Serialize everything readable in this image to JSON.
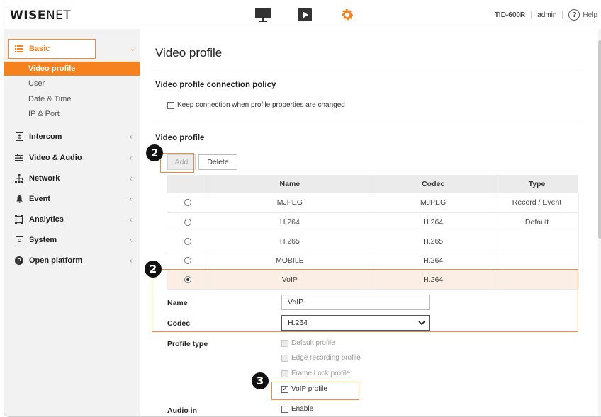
{
  "header": {
    "logo_bold": "WISE",
    "logo_thin": "NET",
    "nav_icons": [
      "monitor-icon",
      "play-icon",
      "gear-icon"
    ],
    "model": "TID-600R",
    "user": "admin",
    "help_label": "Help",
    "help_glyph": "?"
  },
  "sidebar": {
    "basic": {
      "label": "Basic",
      "icon": "list-icon"
    },
    "basic_subitems": [
      "Video profile",
      "User",
      "Date & Time",
      "IP & Port"
    ],
    "active_subitem": "Video profile",
    "items": [
      {
        "label": "Intercom",
        "icon": "intercom-icon"
      },
      {
        "label": "Video & Audio",
        "icon": "video-audio-icon"
      },
      {
        "label": "Network",
        "icon": "network-icon"
      },
      {
        "label": "Event",
        "icon": "bell-icon"
      },
      {
        "label": "Analytics",
        "icon": "analytics-icon"
      },
      {
        "label": "System",
        "icon": "system-icon"
      },
      {
        "label": "Open platform",
        "icon": "open-platform-icon"
      }
    ]
  },
  "main": {
    "title": "Video profile",
    "policy_title": "Video profile connection policy",
    "policy_checkbox": "Keep connection when profile properties are changed",
    "profile_section_title": "Video profile",
    "add_button": "Add",
    "delete_button": "Delete",
    "table": {
      "columns": [
        "",
        "Name",
        "Codec",
        "Type"
      ],
      "rows": [
        {
          "name": "MJPEG",
          "codec": "MJPEG",
          "type": "Record / Event",
          "selected": false
        },
        {
          "name": "H.264",
          "codec": "H.264",
          "type": "Default",
          "selected": false
        },
        {
          "name": "H.265",
          "codec": "H.265",
          "type": "",
          "selected": false
        },
        {
          "name": "MOBILE",
          "codec": "H.264",
          "type": "",
          "selected": false
        },
        {
          "name": "VoIP",
          "codec": "H.264",
          "type": "",
          "selected": true
        }
      ]
    },
    "name_label": "Name",
    "name_value": "VoIP",
    "codec_label": "Codec",
    "codec_value": "H.264",
    "profile_type_label": "Profile type",
    "profile_types": [
      {
        "label": "Default profile",
        "checked": false,
        "disabled": true
      },
      {
        "label": "Edge recording profile",
        "checked": false,
        "disabled": true
      },
      {
        "label": "Frame Lock profile",
        "checked": false,
        "disabled": true
      },
      {
        "label": "VoIP profile",
        "checked": true,
        "disabled": false
      }
    ],
    "audio_in_label": "Audio in",
    "audio_in_checkbox": "Enable"
  },
  "annotations": {
    "badge_add": "2",
    "badge_row": "2",
    "badge_voip": "3",
    "highlight_color": "#f08a3c"
  },
  "colors": {
    "accent": "#f5821f",
    "selected_row": "#fbeee4"
  }
}
